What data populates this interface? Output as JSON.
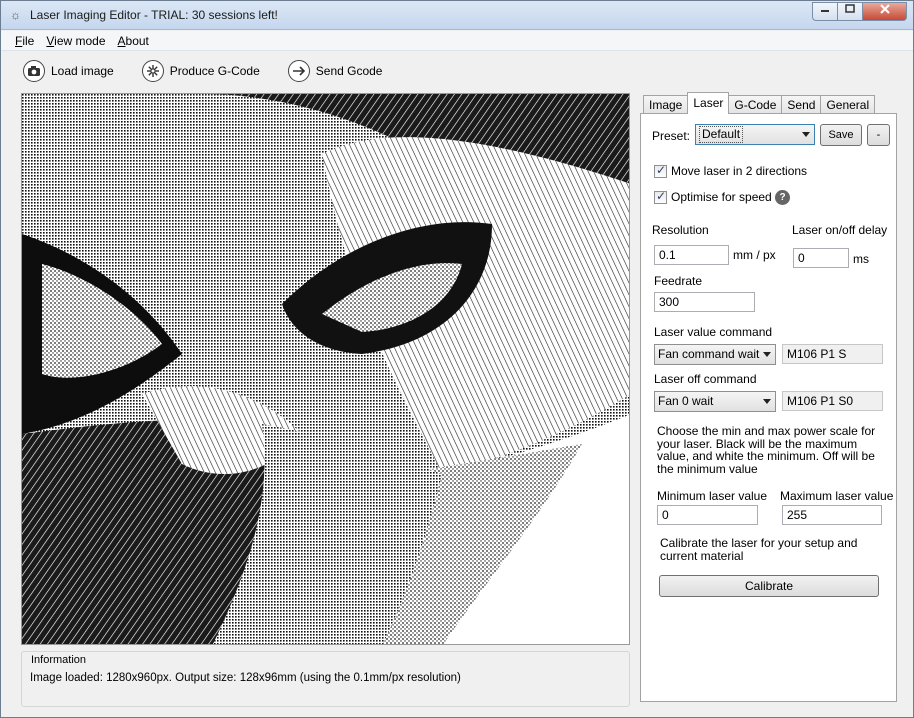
{
  "window": {
    "title": "Laser Imaging Editor - TRIAL: 30 sessions left!"
  },
  "menu": {
    "file": {
      "u": "F",
      "rest": "ile"
    },
    "view": {
      "u": "V",
      "rest": "iew mode"
    },
    "about": {
      "u": "A",
      "rest": "bout"
    }
  },
  "toolbar": {
    "load": "Load image",
    "produce": "Produce G-Code",
    "send": "Send Gcode"
  },
  "info": {
    "title": "Information",
    "text": "Image loaded: 1280x960px. Output size: 128x96mm (using the 0.1mm/px resolution)"
  },
  "tabs": [
    "Image",
    "Laser",
    "G-Code",
    "Send",
    "General"
  ],
  "laser": {
    "preset_label": "Preset:",
    "preset_value": "Default",
    "save": "Save",
    "minus": "-",
    "move_two_dir": "Move laser in 2 directions",
    "optimise": "Optimise for speed",
    "help": "?",
    "resolution_label": "Resolution",
    "resolution_value": "0.1",
    "resolution_unit": "mm / px",
    "delay_label": "Laser on/off delay",
    "delay_value": "0",
    "delay_unit": "ms",
    "feedrate_label": "Feedrate",
    "feedrate_value": "300",
    "value_cmd_label": "Laser value command",
    "value_cmd_select": "Fan command wait",
    "value_cmd_text": "M106 P1 S",
    "off_cmd_label": "Laser off command",
    "off_cmd_select": "Fan 0 wait",
    "off_cmd_text": "M106 P1 S0",
    "scale_note": [
      "Choose the min and max power scale for",
      "your laser. Black will be the maximum",
      "value, and white the minimum. Off will be",
      "the minimum value"
    ],
    "min_label": "Minimum laser value",
    "min_value": "0",
    "max_label": "Maximum laser value",
    "max_value": "255",
    "calib_note": [
      "Calibrate the laser for your setup and",
      "current material"
    ],
    "calibrate": "Calibrate"
  },
  "colors": {
    "accent": "#3c7fb1",
    "title_bar": "#c5d7ee",
    "close": "#c74a35"
  }
}
